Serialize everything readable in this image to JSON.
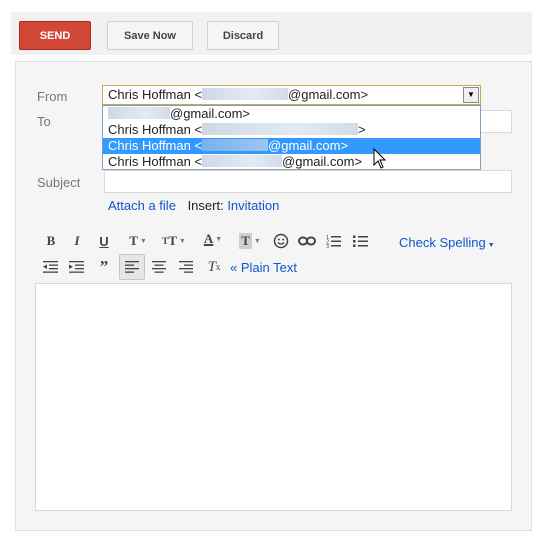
{
  "toolbar": {
    "send_label": "SEND",
    "save_label": "Save Now",
    "discard_label": "Discard"
  },
  "fields": {
    "from_label": "From",
    "to_label": "To",
    "subject_label": "Subject"
  },
  "from": {
    "selected_name": "Chris Hoffman <",
    "selected_domain": "@gmail.com>",
    "options": [
      {
        "name": "",
        "domain": "@gmail.com>"
      },
      {
        "name": "Chris Hoffman <",
        "domain": ">"
      },
      {
        "name": "Chris Hoffman <",
        "domain": "@gmail.com>",
        "selected": true
      },
      {
        "name": "Chris Hoffman <",
        "domain": "@gmail.com>"
      }
    ]
  },
  "attach": {
    "attach_label": "Attach a file",
    "insert_label": "Insert:",
    "invitation_label": "Invitation"
  },
  "format": {
    "check_spelling_label": "Check Spelling",
    "plain_text_label": "« Plain Text"
  },
  "colors": {
    "send": "#d14836",
    "link": "#1155cc",
    "selected_option": "#3399ff"
  }
}
